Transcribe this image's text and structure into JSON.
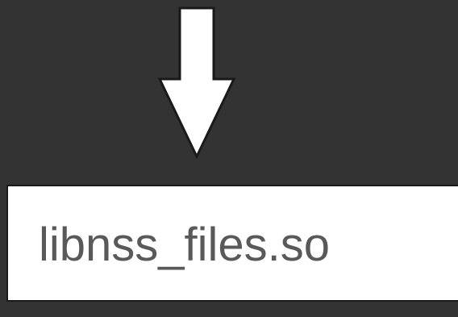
{
  "diagram": {
    "arrow_icon": "down-arrow-icon",
    "file_label": "libnss_files.so"
  },
  "colors": {
    "background": "#333333",
    "arrow_fill": "#ffffff",
    "arrow_stroke": "#1a1a1a",
    "box_fill": "#ffffff",
    "box_border": "#1a1a1a",
    "label_text": "#595959"
  }
}
